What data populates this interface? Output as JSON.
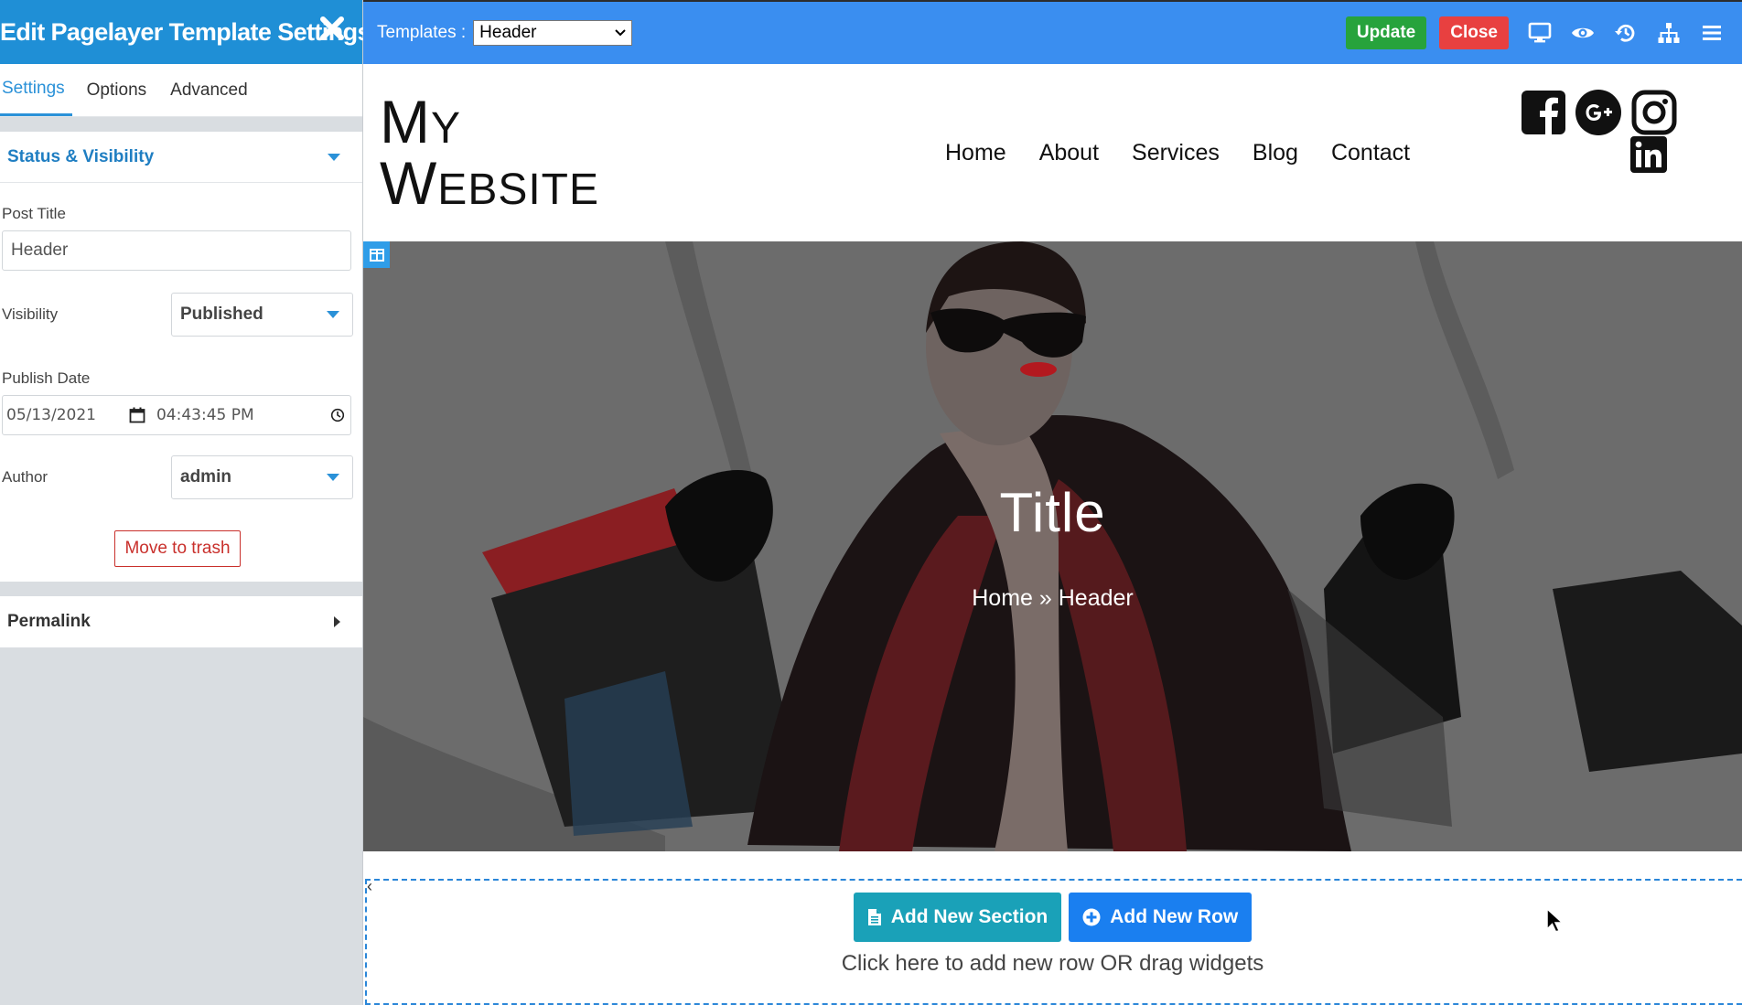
{
  "panel": {
    "title": "Edit Pagelayer Template Settings",
    "tabs": [
      {
        "label": "Settings",
        "active": true
      },
      {
        "label": "Options",
        "active": false
      },
      {
        "label": "Advanced",
        "active": false
      }
    ],
    "status_section": {
      "title": "Status & Visibility",
      "post_title_label": "Post Title",
      "post_title_value": "Header",
      "visibility_label": "Visibility",
      "visibility_value": "Published",
      "publish_date_label": "Publish Date",
      "publish_date_value": "05/13/2021",
      "publish_time_value": "04:43:45 PM",
      "author_label": "Author",
      "author_value": "admin",
      "trash_label": "Move to trash"
    },
    "permalink_section": {
      "title": "Permalink"
    }
  },
  "toolbar": {
    "templates_label": "Templates :",
    "template_value": "Header",
    "update_label": "Update",
    "close_label": "Close",
    "icons": [
      "desktop-icon",
      "eye-icon",
      "history-icon",
      "sitemap-icon",
      "menu-icon"
    ]
  },
  "site": {
    "logo_line1_cap": "M",
    "logo_line1_rest": "Y",
    "logo_line2_cap": "W",
    "logo_line2_rest": "EBSITE",
    "nav": [
      "Home",
      "About",
      "Services",
      "Blog",
      "Contact"
    ],
    "social": [
      "facebook-icon",
      "google-plus-icon",
      "instagram-icon",
      "linkedin-icon"
    ]
  },
  "hero": {
    "title": "Title",
    "breadcrumb": "Home » Header"
  },
  "add_zone": {
    "add_section_label": "Add New Section",
    "add_row_label": "Add New Row",
    "hint": "Click here to add new row OR drag widgets"
  },
  "colors": {
    "panel_blue": "#1f8fd6",
    "toolbar_blue": "#3a8ef0",
    "update_green": "#27a33c",
    "close_red": "#e84040",
    "add_section_teal": "#1aa1b8",
    "add_row_blue": "#1a7ff0"
  }
}
